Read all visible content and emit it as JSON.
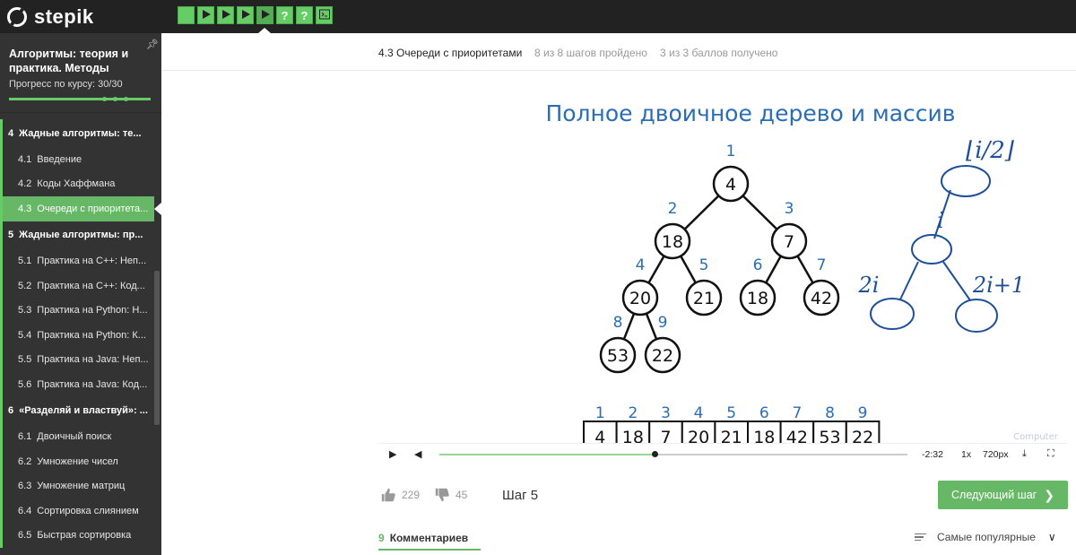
{
  "brand": {
    "name": "stepik"
  },
  "step_buttons": [
    {
      "kind": "square"
    },
    {
      "kind": "play"
    },
    {
      "kind": "play"
    },
    {
      "kind": "play"
    },
    {
      "kind": "play",
      "active": true
    },
    {
      "kind": "question",
      "label": "?"
    },
    {
      "kind": "question",
      "label": "?"
    },
    {
      "kind": "terminal"
    }
  ],
  "sidebar": {
    "course_title": "Алгоритмы: теория и практика. Методы",
    "progress_label": "Прогресс по курсу:  30/30",
    "progress_percent": 100,
    "items": [
      {
        "num": "4",
        "label": "Жадные алгоритмы: те...",
        "type": "module"
      },
      {
        "num": "4.1",
        "label": "Введение",
        "type": "lesson"
      },
      {
        "num": "4.2",
        "label": "Коды Хаффмана",
        "type": "lesson"
      },
      {
        "num": "4.3",
        "label": "Очереди с приоритета...",
        "type": "lesson",
        "active": true
      },
      {
        "num": "5",
        "label": "Жадные алгоритмы: пр...",
        "type": "module"
      },
      {
        "num": "5.1",
        "label": "Практика на C++: Неп...",
        "type": "lesson"
      },
      {
        "num": "5.2",
        "label": "Практика на C++: Код...",
        "type": "lesson"
      },
      {
        "num": "5.3",
        "label": "Практика на Python: Н...",
        "type": "lesson"
      },
      {
        "num": "5.4",
        "label": "Практика на Python: К...",
        "type": "lesson"
      },
      {
        "num": "5.5",
        "label": "Практика на Java: Неп...",
        "type": "lesson"
      },
      {
        "num": "5.6",
        "label": "Практика на Java: Код...",
        "type": "lesson"
      },
      {
        "num": "6",
        "label": "«Разделяй и властвуй»: ...",
        "type": "module"
      },
      {
        "num": "6.1",
        "label": "Двоичный поиск",
        "type": "lesson"
      },
      {
        "num": "6.2",
        "label": "Умножение чисел",
        "type": "lesson"
      },
      {
        "num": "6.3",
        "label": "Умножение матриц",
        "type": "lesson"
      },
      {
        "num": "6.4",
        "label": "Сортировка слиянием",
        "type": "lesson"
      },
      {
        "num": "6.5",
        "label": "Быстрая сортировка",
        "type": "lesson"
      }
    ]
  },
  "lesson_header": {
    "title": "4.3 Очереди с приоритетами",
    "steps_done": "8 из 8 шагов пройдено",
    "points": "3 из 3 баллов  получено"
  },
  "video": {
    "slide_title": "Полное двоичное дерево и массив",
    "tree_nodes": [
      {
        "index": "1",
        "value": "4"
      },
      {
        "index": "2",
        "value": "18"
      },
      {
        "index": "3",
        "value": "7"
      },
      {
        "index": "4",
        "value": "20"
      },
      {
        "index": "5",
        "value": "21"
      },
      {
        "index": "6",
        "value": "18"
      },
      {
        "index": "7",
        "value": "42"
      },
      {
        "index": "8",
        "value": "53"
      },
      {
        "index": "9",
        "value": "22"
      }
    ],
    "array_indices": [
      "1",
      "2",
      "3",
      "4",
      "5",
      "6",
      "7",
      "8",
      "9"
    ],
    "array_values": [
      "4",
      "18",
      "7",
      "20",
      "21",
      "18",
      "42",
      "53",
      "22"
    ],
    "handwriting": {
      "parent": "⌊i/2⌋",
      "node": "i",
      "left": "2i",
      "right": "2i+1"
    },
    "watermark": "Computer"
  },
  "player": {
    "progress_percent": 46,
    "time_remaining": "-2:32",
    "speed": "1x",
    "quality": "720px"
  },
  "footer": {
    "likes": "229",
    "dislikes": "45",
    "step_label": "Шаг 5",
    "next_button": "Следующий шаг"
  },
  "comments": {
    "count": "9",
    "tab_label": "Комментариев",
    "sort_label": "Самые популярные"
  },
  "colors": {
    "accent": "#66b866",
    "topbar": "#222222",
    "sidebar": "#333333",
    "slide_blue": "#2a6db5"
  }
}
